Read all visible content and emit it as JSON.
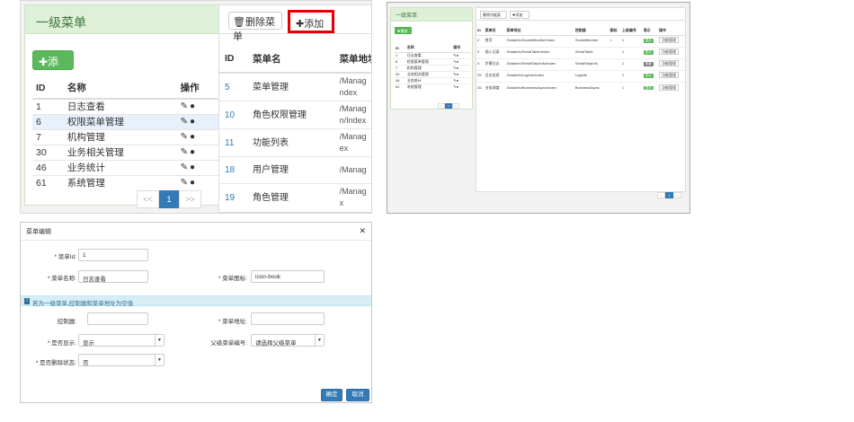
{
  "panel_main": {
    "menu_title": "一级菜单",
    "add_label": "✚添加",
    "table": {
      "headers": [
        "ID",
        "名称",
        "操作"
      ],
      "rows": [
        {
          "id": "1",
          "name": "日志查看"
        },
        {
          "id": "6",
          "name": "权限菜单管理"
        },
        {
          "id": "7",
          "name": "机构管理"
        },
        {
          "id": "30",
          "name": "业务相关管理"
        },
        {
          "id": "46",
          "name": "业务统计"
        },
        {
          "id": "61",
          "name": "系统管理"
        }
      ]
    },
    "pager": {
      "prev": "<<",
      "current": "1",
      "next": ">>"
    },
    "toolbar": {
      "delete_label": "🗑删除菜单",
      "add_label": "✚添加"
    },
    "list_table": {
      "headers": [
        "ID",
        "菜单名",
        "菜单地址"
      ],
      "rows": [
        {
          "id": "5",
          "name": "菜单管理",
          "addr": "/Manag\nndex"
        },
        {
          "id": "10",
          "name": "角色权限管理",
          "addr": "/Manag\nn/Index"
        },
        {
          "id": "11",
          "name": "功能列表",
          "addr": "/Manag\nex"
        },
        {
          "id": "18",
          "name": "用户管理",
          "addr": "/Manag"
        },
        {
          "id": "19",
          "name": "角色管理",
          "addr": "/Manag\nx"
        }
      ]
    }
  },
  "panel_small": {
    "menu_title": "一级菜单",
    "add_label": "✚增加",
    "headers": [
      "ID",
      "名称",
      "操作"
    ],
    "rows": [
      {
        "id": "1",
        "name": "日志查看"
      },
      {
        "id": "6",
        "name": "权限菜单管理"
      },
      {
        "id": "7",
        "name": "机构管理"
      },
      {
        "id": "30",
        "name": "业务相关管理"
      },
      {
        "id": "46",
        "name": "业务统计"
      },
      {
        "id": "61",
        "name": "系统管理"
      }
    ],
    "pager": {
      "prev": "<<",
      "current": "1",
      "next": ">>"
    },
    "toolbar": {
      "delete_label": "删除功能菜",
      "add_label": "✚添加"
    },
    "list_headers": [
      "ID",
      "菜单名",
      "菜单地址",
      "控制器",
      "图标",
      "上级编号",
      "显示",
      "操作"
    ],
    "list_rows": [
      {
        "id": "2",
        "name": "首页",
        "addr": "/DataInfo/SocketMonitor/Index",
        "ctrl": "SocketMonitor",
        "icon": "⌂",
        "parent": "1",
        "show": "显示",
        "op": "功能管理"
      },
      {
        "id": "3",
        "name": "插入记录",
        "addr": "/DataInfo/SerialTable/Index",
        "ctrl": "SerialTable",
        "icon": "",
        "parent": "1",
        "show": "显示",
        "op": "功能管理"
      },
      {
        "id": "4",
        "name": "步骤日志",
        "addr": "/DataInfo/SerialStep/Info/Index",
        "ctrl": "SerialStepInfo",
        "icon": "",
        "parent": "1",
        "show": "隐藏",
        "op": "功能管理"
      },
      {
        "id": "25",
        "name": "日志信息",
        "addr": "/DataInfo/LogInfo/Index",
        "ctrl": "LogInfo",
        "icon": "",
        "parent": "1",
        "show": "显示",
        "op": "功能管理"
      },
      {
        "id": "26",
        "name": "业务调度",
        "addr": "/DataInfo/BusinessAsync/Index",
        "ctrl": "BusinessAsync",
        "icon": "",
        "parent": "1",
        "show": "显示",
        "op": "功能管理"
      }
    ],
    "list_pager": {
      "prev": "<<",
      "current": "1",
      "next": ">>"
    }
  },
  "dialog": {
    "title": "菜单编辑",
    "close": "✕",
    "fields": {
      "menu_id_label": "* 菜单Id:",
      "menu_id_value": "1",
      "menu_name_label": "* 菜单名称:",
      "menu_name_value": "日志查看",
      "menu_icon_label": "* 菜单图标:",
      "menu_icon_value": "icon-book",
      "controller_label": "控制器:",
      "controller_value": "",
      "menu_addr_label": "* 菜单地址:",
      "menu_addr_value": "",
      "show_label": "* 是否显示:",
      "show_value": "显示",
      "parent_label": "父级菜单编号:",
      "parent_value": "请选择父级菜单",
      "deleted_label": "* 是否删除状态:",
      "deleted_value": "否"
    },
    "info_text": "若为一级菜单,控制器和菜单地址为空值",
    "ok_label": "确定",
    "cancel_label": "取消"
  }
}
